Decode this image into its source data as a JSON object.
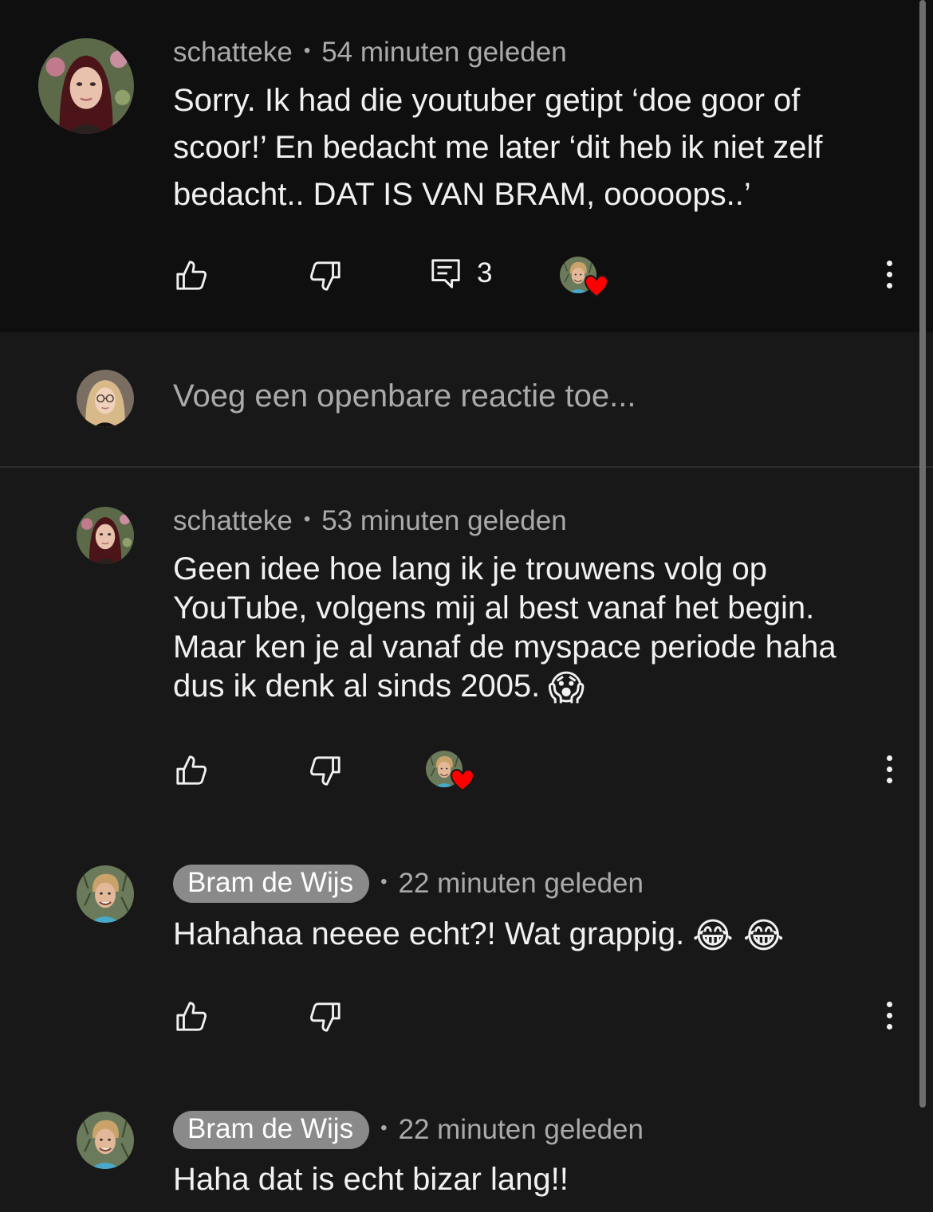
{
  "comment": {
    "author": "schatteke",
    "time": "54 minuten geleden",
    "lines": [
      "Sorry. Ik had die youtuber getipt ‘doe goor of",
      "scoor!’ En bedacht me later ‘dit heb ik niet zelf",
      "bedacht.. DAT IS VAN BRAM, ooooops..’"
    ],
    "reply_count": "3",
    "icons": {
      "like": "thumb-up-icon",
      "dislike": "thumb-down-icon",
      "reply": "comment-icon",
      "more": "more-vert-icon",
      "heart": "creator-heart-icon"
    }
  },
  "add_reply": {
    "placeholder": "Voeg een openbare reactie toe..."
  },
  "replies": [
    {
      "author": "schatteke",
      "time": "53 minuten geleden",
      "lines": [
        "Geen idee hoe lang ik je trouwens volg op",
        "YouTube, volgens mij al best vanaf het begin.",
        "Maar ken je al vanaf de myspace periode haha",
        "dus ik denk al sinds 2005."
      ],
      "emoji": "😱",
      "hearted": true
    },
    {
      "author": "Bram de Wijs",
      "time": "22 minuten geleden",
      "lines": [
        "Hahahaa neeee echt?! Wat grappig."
      ],
      "emoji": "😂 😂",
      "hearted": false
    },
    {
      "author": "Bram de Wijs",
      "time": "22 minuten geleden",
      "lines": [
        "Haha dat is echt bizar lang!!"
      ],
      "emoji": "",
      "hearted": false
    }
  ],
  "colors": {
    "background": "#181818",
    "highlight_background": "#0f0f0f",
    "secondary_text": "#aaaaaa",
    "creator_chip": "#8a8a8a",
    "heart": "#ff0000"
  }
}
